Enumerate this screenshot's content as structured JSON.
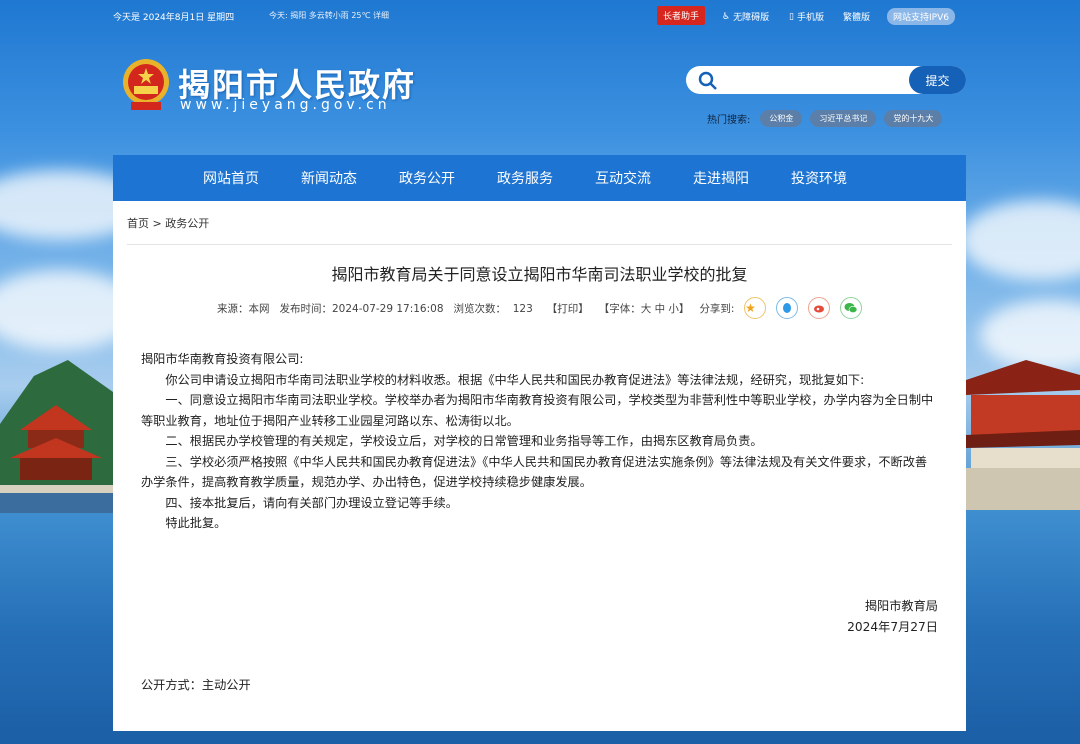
{
  "topbar": {
    "date": "今天是 2024年8月1日 星期四",
    "weather": "今天: 揭阳 多云转小雨 25℃ 详细",
    "elder": "长者助手",
    "accessible": "无障碍版",
    "mobile": "手机版",
    "traditional": "繁體版",
    "ipv6": "网站支持IPV6"
  },
  "header": {
    "site_name": "揭阳市人民政府",
    "site_url": "www.jieyang.gov.cn",
    "search_placeholder": "",
    "search_button": "提交",
    "hot_label": "热门搜索:",
    "hot_tags": [
      "公积金",
      "习近平总书记",
      "党的十九大"
    ]
  },
  "nav": [
    "网站首页",
    "新闻动态",
    "政务公开",
    "政务服务",
    "互动交流",
    "走进揭阳",
    "投资环境"
  ],
  "breadcrumb": "首页 > 政务公开",
  "article": {
    "title": "揭阳市教育局关于同意设立揭阳市华南司法职业学校的批复",
    "source": "来源：本网",
    "published": "发布时间：2024-07-29 17:16:08",
    "views": "浏览次数：  123",
    "print": "【打印】",
    "font": "【字体：大 中 小】",
    "share_label": "分享到:",
    "paragraphs": [
      "揭阳市华南教育投资有限公司:",
      "你公司申请设立揭阳市华南司法职业学校的材料收悉。根据《中华人民共和国民办教育促进法》等法律法规，经研究，现批复如下:",
      "一、同意设立揭阳市华南司法职业学校。学校举办者为揭阳市华南教育投资有限公司，学校类型为非营利性中等职业学校，办学内容为全日制中等职业教育，地址位于揭阳产业转移工业园星河路以东、松涛街以北。",
      "二、根据民办学校管理的有关规定，学校设立后，对学校的日常管理和业务指导等工作，由揭东区教育局负责。",
      "三、学校必须严格按照《中华人民共和国民办教育促进法》《中华人民共和国民办教育促进法实施条例》等法律法规及有关文件要求，不断改善办学条件，提高教育教学质量，规范办学、办出特色，促进学校持续稳步健康发展。",
      "四、接本批复后，请向有关部门办理设立登记等手续。",
      "特此批复。"
    ],
    "signature_org": "揭阳市教育局",
    "signature_date": "2024年7月27日",
    "disclosure": "公开方式：主动公开"
  },
  "colors": {
    "nav_bg": "#1e74d2",
    "elder_bg": "#d7261e",
    "search_btn": "#1561b8"
  }
}
